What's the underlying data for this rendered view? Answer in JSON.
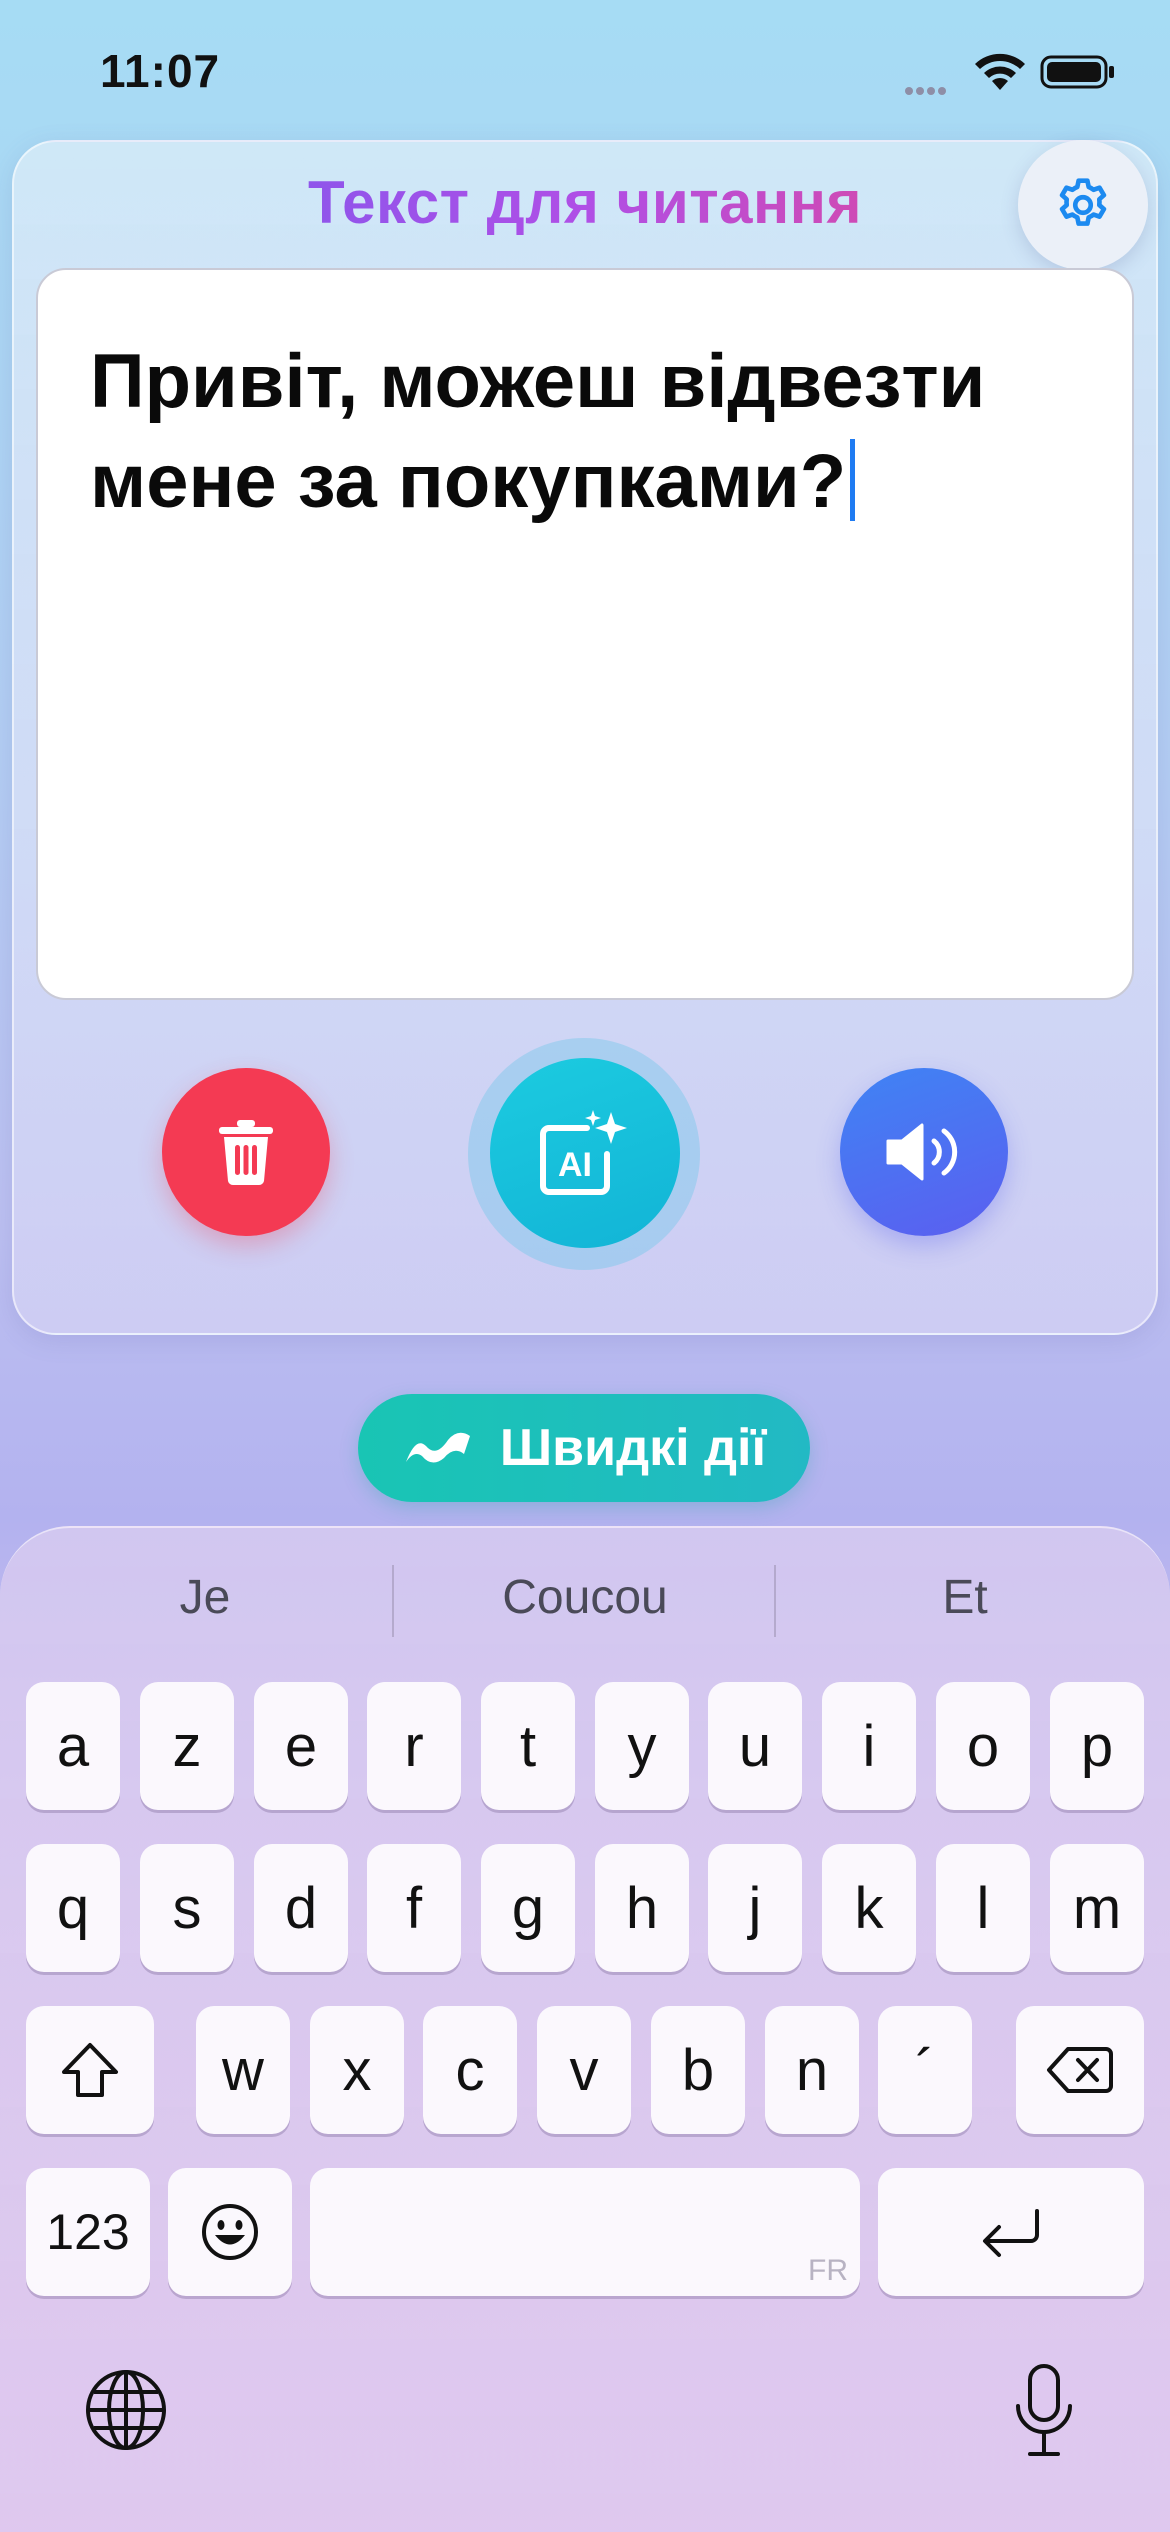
{
  "status_bar": {
    "time": "11:07"
  },
  "card": {
    "title": "Текст для читання",
    "text_line1": "Привіт, можеш відвезти",
    "text_line2": "мене за покупками?"
  },
  "buttons": {
    "delete_icon": "trash-icon",
    "ai_icon": "ai-sparkle-icon",
    "ai_label": "AI",
    "speak_icon": "speaker-icon",
    "settings_icon": "gear-icon"
  },
  "quick_actions": {
    "label": "Швидкі дії",
    "icon": "zigzag-icon"
  },
  "keyboard": {
    "suggestions": [
      "Je",
      "Coucou",
      "Et"
    ],
    "row1": [
      "a",
      "z",
      "e",
      "r",
      "t",
      "y",
      "u",
      "i",
      "o",
      "p"
    ],
    "row2": [
      "q",
      "s",
      "d",
      "f",
      "g",
      "h",
      "j",
      "k",
      "l",
      "m"
    ],
    "row3": [
      "w",
      "x",
      "c",
      "v",
      "b",
      "n",
      "´"
    ],
    "numbers_key": "123",
    "space_lang": "FR"
  },
  "colors": {
    "delete": "#f43a53",
    "ai": "#12b4d6",
    "speak": "#5b5ef0",
    "quick_actions": "#19c5b4",
    "caret": "#1f7bf2"
  }
}
